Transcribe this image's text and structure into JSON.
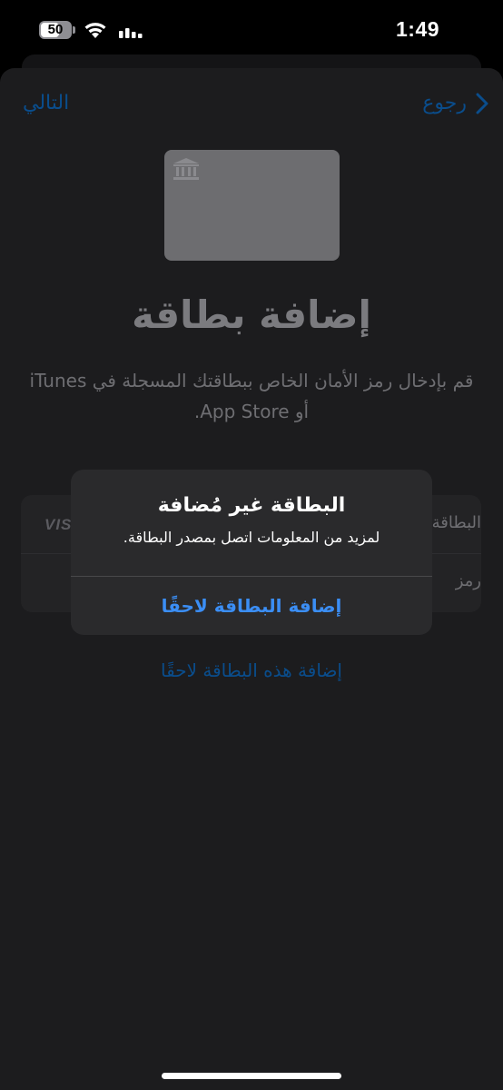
{
  "status_bar": {
    "time": "1:49",
    "battery": "50"
  },
  "nav": {
    "next_label": "التالي",
    "back_label": "رجوع"
  },
  "page": {
    "title": "إضافة بطاقة",
    "description": "قم بإدخال رمز الأمان الخاص ببطاقتك المسجلة في iTunes أو App Store."
  },
  "form": {
    "row1_label": "البطاقة",
    "row1_brand": "VISA",
    "row2_label": "رمز"
  },
  "add_later_link": "إضافة هذه البطاقة لاحقًا",
  "alert": {
    "title": "البطاقة غير مُضافة",
    "message": "لمزيد من المعلومات اتصل بمصدر البطاقة.",
    "button": "إضافة البطاقة لاحقًا"
  },
  "colors": {
    "accent": "#3b8ef5",
    "link_dim": "#0a4d8c",
    "sheet": "#1c1c1e"
  },
  "icons": [
    "battery-icon",
    "wifi-icon",
    "cellular-signal-icon",
    "chevron-right-icon",
    "bank-icon"
  ]
}
